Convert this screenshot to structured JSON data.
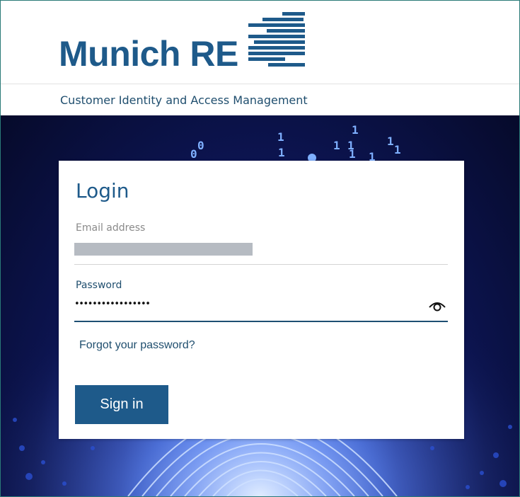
{
  "brand": {
    "name": "Munich RE",
    "subtitle": "Customer Identity and Access Management",
    "primary_color": "#1e5a8a"
  },
  "login": {
    "title": "Login",
    "email": {
      "label": "Email address",
      "value": ""
    },
    "password": {
      "label": "Password",
      "masked_value": "•••••••••••••••••",
      "toggle_icon": "eye-icon"
    },
    "forgot_link": "Forgot your password?",
    "submit_label": "Sign in"
  },
  "background": {
    "digits": [
      "0",
      "0",
      "1",
      "1",
      "1",
      "1",
      "1",
      "1",
      "1",
      "1",
      "1"
    ]
  }
}
